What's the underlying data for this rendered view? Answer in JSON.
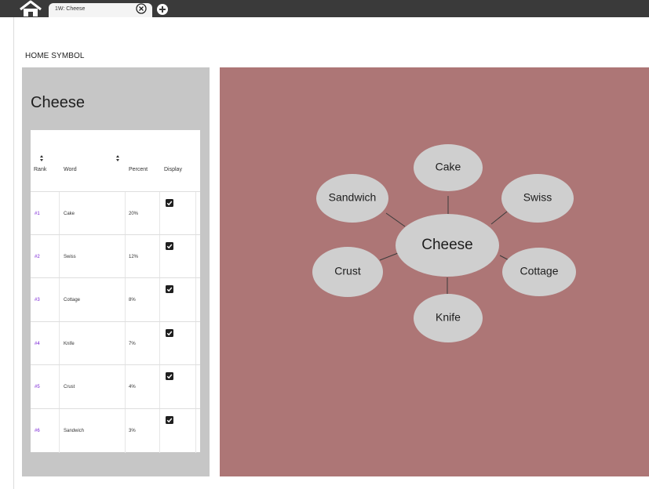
{
  "tab": {
    "label": "1W: Cheese"
  },
  "breadcrumb": "HOME SYMBOL",
  "panel": {
    "title": "Cheese"
  },
  "table": {
    "headers": {
      "rank": "Rank",
      "word": "Word",
      "percent": "Percent",
      "display": "Display"
    },
    "rows": [
      {
        "rank": "#1",
        "word": "Cake",
        "percent": "20%",
        "display": true
      },
      {
        "rank": "#2",
        "word": "Swiss",
        "percent": "12%",
        "display": true
      },
      {
        "rank": "#3",
        "word": "Cottage",
        "percent": "8%",
        "display": true
      },
      {
        "rank": "#4",
        "word": "Knife",
        "percent": "7%",
        "display": true
      },
      {
        "rank": "#5",
        "word": "Crust",
        "percent": "4%",
        "display": true
      },
      {
        "rank": "#6",
        "word": "Sandwich",
        "percent": "3%",
        "display": true
      }
    ]
  },
  "map": {
    "center": "Cheese",
    "nodes": [
      "Cake",
      "Swiss",
      "Cottage",
      "Knife",
      "Crust",
      "Sandwich"
    ]
  },
  "colors": {
    "topbar": "#3a3a3a",
    "panel": "#c6c6c6",
    "map_background": "#ad7676",
    "node_fill": "#cfcfcf",
    "rank_text": "#7a24d6"
  }
}
